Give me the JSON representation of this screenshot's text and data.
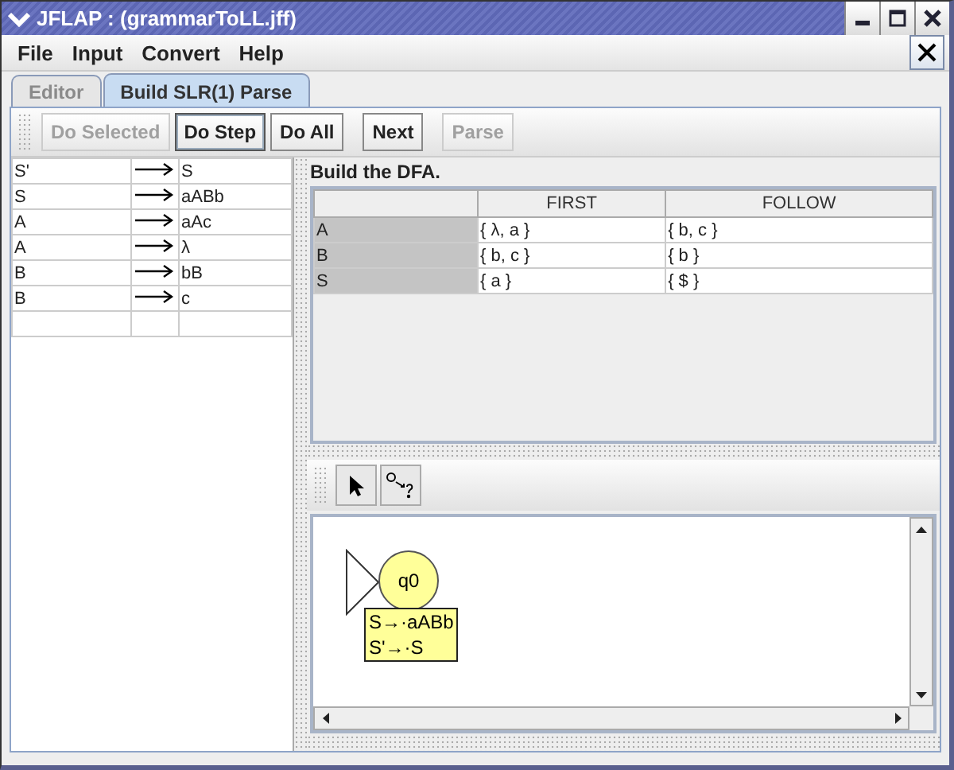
{
  "window": {
    "title": "JFLAP : (grammarToLL.jff)"
  },
  "menu": [
    "File",
    "Input",
    "Convert",
    "Help"
  ],
  "tabs": [
    {
      "label": "Editor",
      "selected": false
    },
    {
      "label": "Build SLR(1) Parse",
      "selected": true
    }
  ],
  "toolbar": [
    [
      {
        "label": "Do Selected",
        "disabled": true,
        "focused": false
      },
      {
        "label": "Do Step",
        "disabled": false,
        "focused": true
      },
      {
        "label": "Do All",
        "disabled": false,
        "focused": false
      }
    ],
    [
      {
        "label": "Next",
        "disabled": false,
        "focused": false
      }
    ],
    [
      {
        "label": "Parse",
        "disabled": true,
        "focused": false
      }
    ]
  ],
  "grammar": [
    {
      "lhs": "S'",
      "rhs": "S"
    },
    {
      "lhs": "S",
      "rhs": "aABb"
    },
    {
      "lhs": "A",
      "rhs": "aAc"
    },
    {
      "lhs": "A",
      "rhs": "λ"
    },
    {
      "lhs": "B",
      "rhs": "bB"
    },
    {
      "lhs": "B",
      "rhs": "c"
    }
  ],
  "instruction": "Build the DFA.",
  "sets_table": {
    "columns": [
      "FIRST",
      "FOLLOW"
    ],
    "rows": [
      {
        "symbol": "A",
        "first": "{ λ, a }",
        "follow": "{ b, c }"
      },
      {
        "symbol": "B",
        "first": "{ b, c }",
        "follow": "{ b }"
      },
      {
        "symbol": "S",
        "first": "{ a }",
        "follow": "{ $ }"
      }
    ]
  },
  "states": [
    {
      "name": "q0",
      "initial": true,
      "items": [
        "S→·aABb",
        "S'→·S"
      ]
    }
  ]
}
